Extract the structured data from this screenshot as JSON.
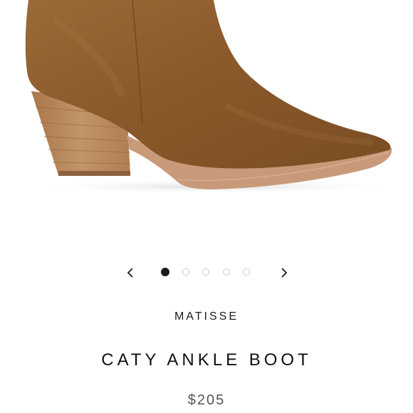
{
  "product": {
    "brand": "MATISSE",
    "name": "CATY ANKLE BOOT",
    "price": "$205"
  },
  "carousel": {
    "total_images": 5,
    "active_index": 0,
    "prev_icon": "chevron-left-icon",
    "next_icon": "chevron-right-icon"
  },
  "colors": {
    "suede": "#8a5a2b",
    "heel_wood": "#b98a5f",
    "sole": "#c99a7a",
    "active_dot": "#1a1a1a"
  }
}
